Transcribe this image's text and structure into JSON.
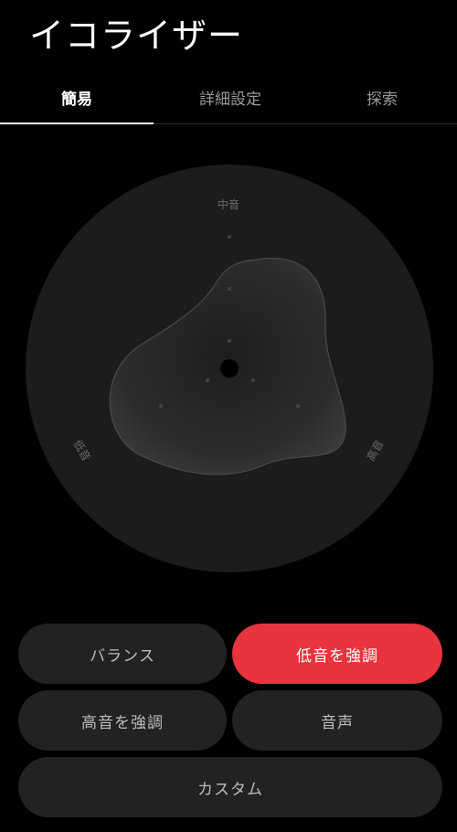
{
  "header": {
    "title": "イコライザー"
  },
  "tabs": [
    {
      "label": "簡易",
      "active": true
    },
    {
      "label": "詳細設定",
      "active": false
    },
    {
      "label": "探索",
      "active": false
    }
  ],
  "equalizer": {
    "axis_labels": {
      "top": "中音",
      "left": "低音",
      "right": "高音"
    }
  },
  "presets": [
    {
      "label": "バランス",
      "active": false
    },
    {
      "label": "低音を強調",
      "active": true
    },
    {
      "label": "高音を強調",
      "active": false
    },
    {
      "label": "音声",
      "active": false
    },
    {
      "label": "カスタム",
      "active": false
    }
  ],
  "colors": {
    "accent": "#e8343c",
    "background": "#000000",
    "button_bg": "#222222",
    "dial_bg": "#1c1c1c"
  }
}
